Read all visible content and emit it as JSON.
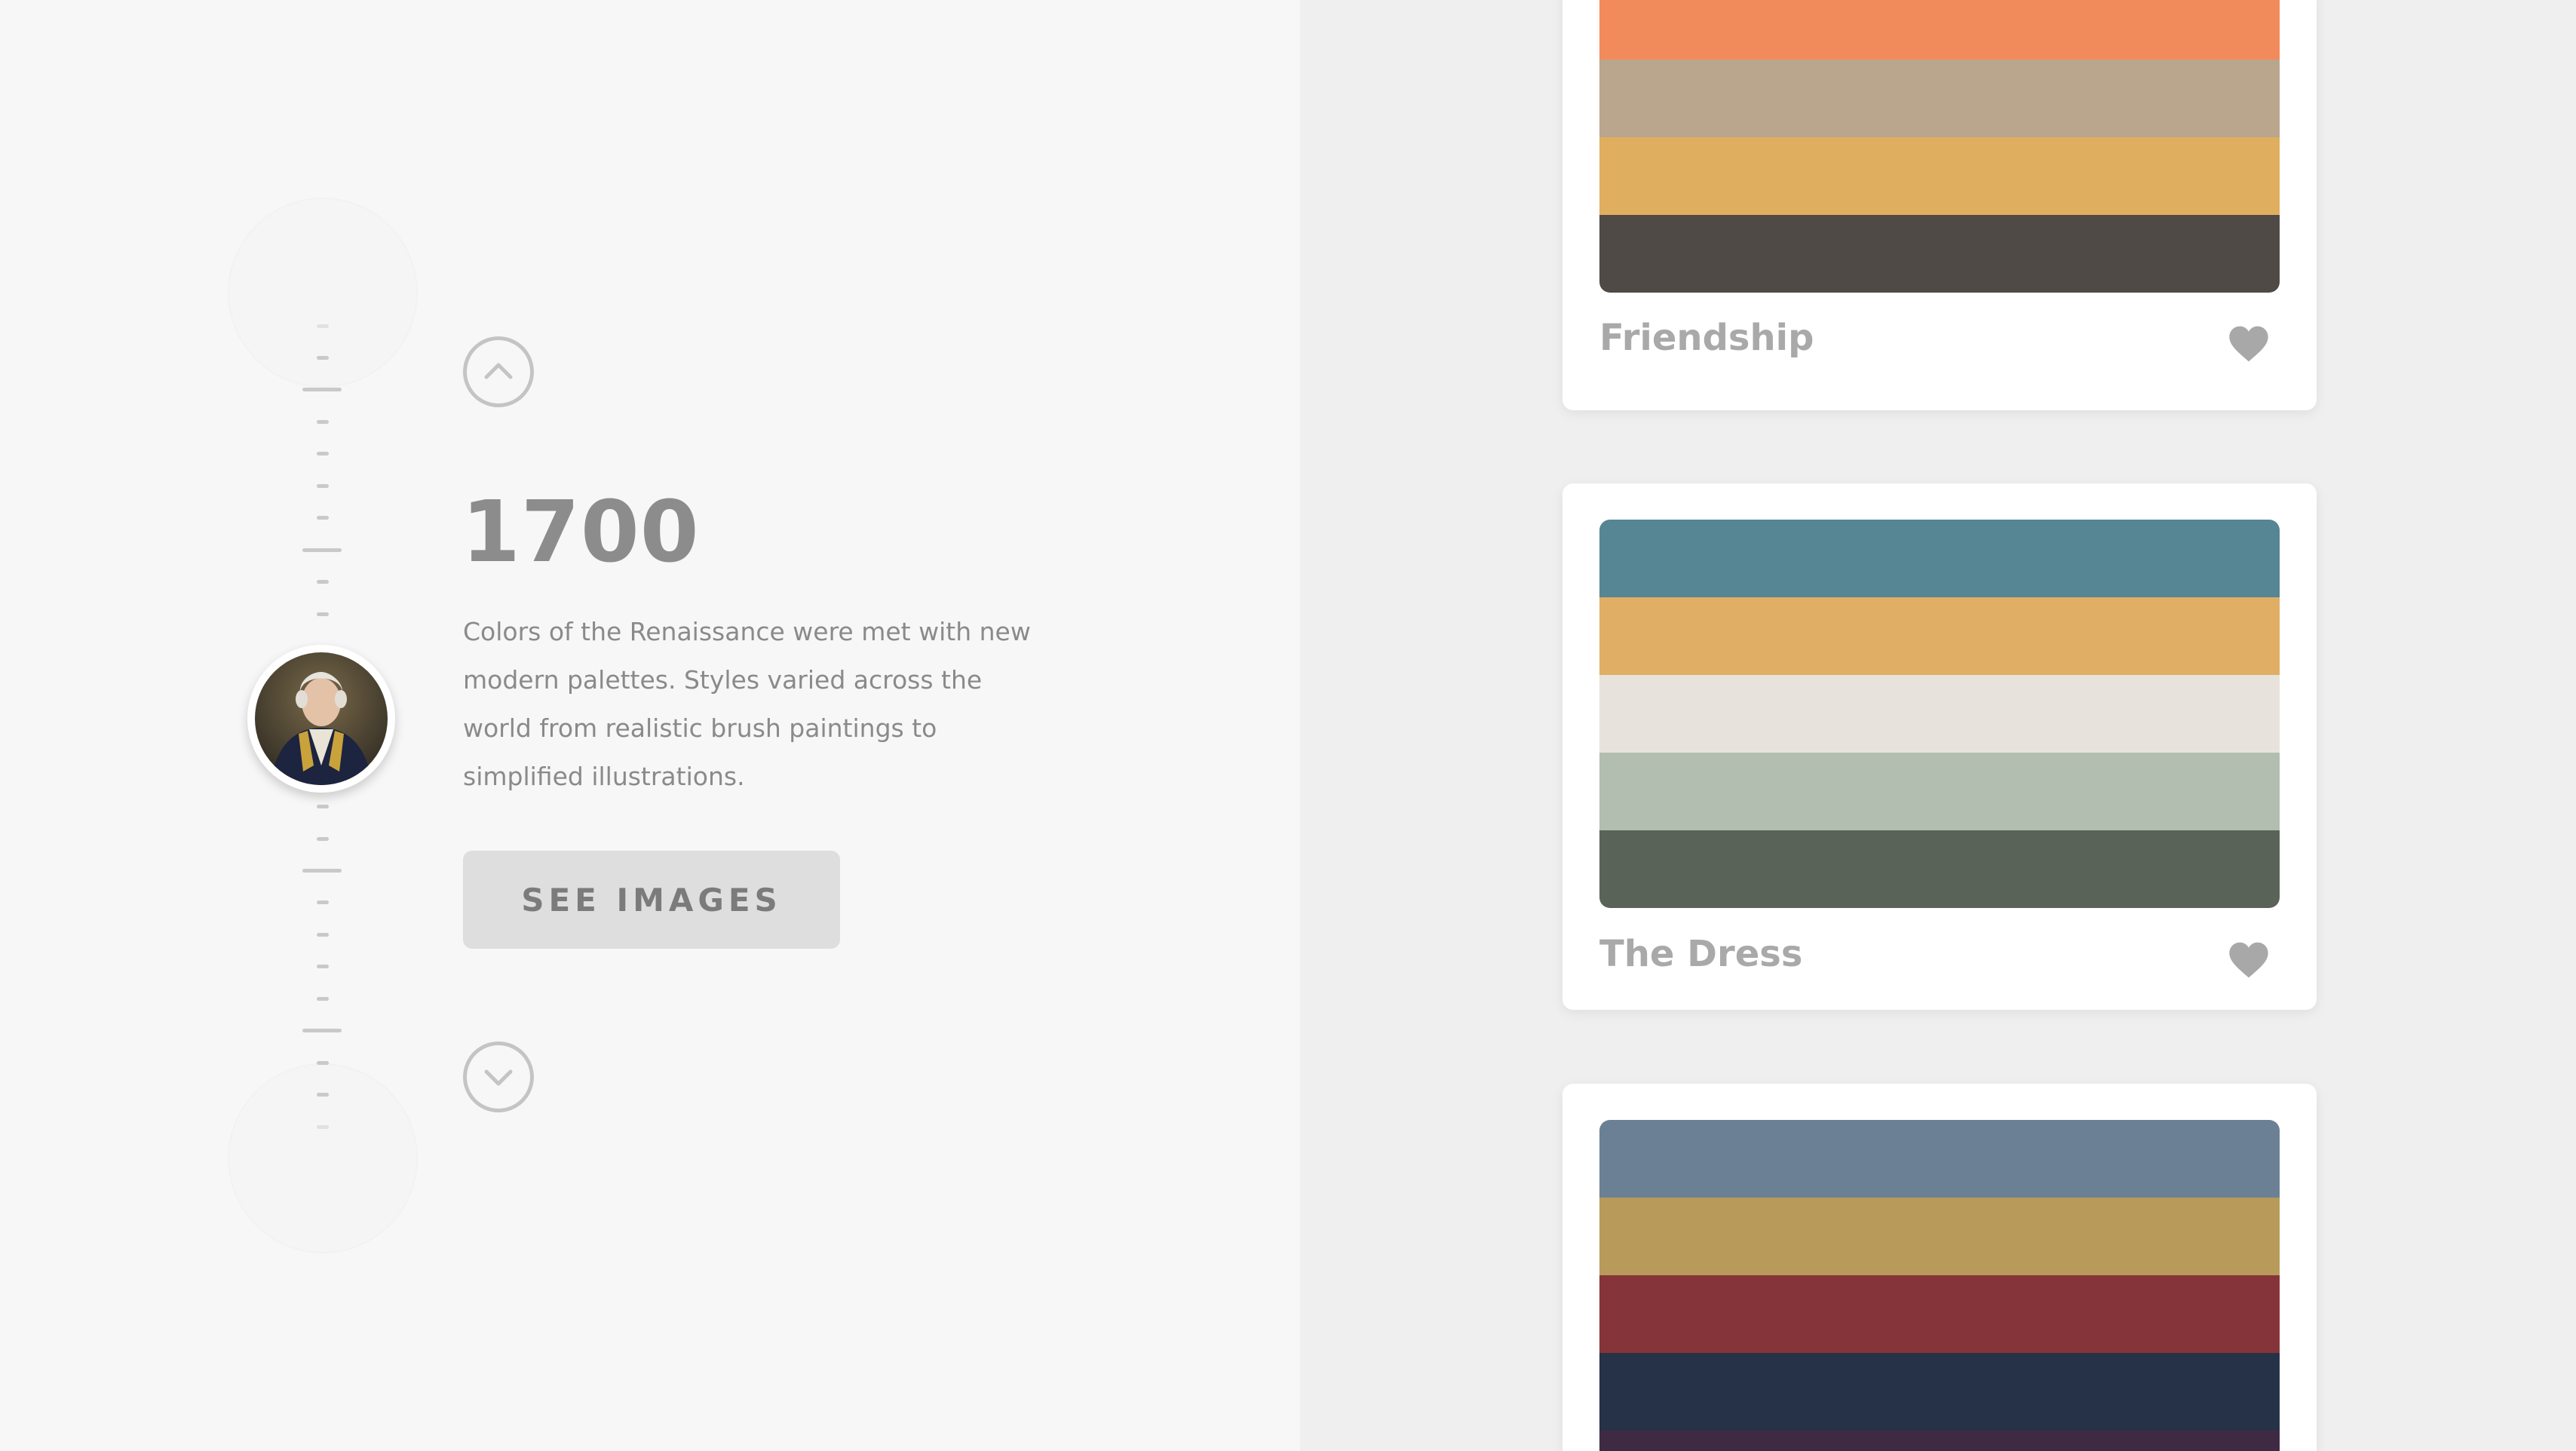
{
  "timeline": {
    "year": "1700",
    "description": "Colors of the Renaissance were met with new modern palettes. Styles varied across the world from realistic brush paintings to simplified illustrations.",
    "see_images_label": "SEE IMAGES",
    "icons": {
      "up": "chevron-up-icon",
      "down": "chevron-down-icon",
      "avatar": "portrait-avatar"
    }
  },
  "palettes": [
    {
      "name": "Friendship",
      "colors": [
        "#f28b5b",
        "#b9a68d",
        "#e0ae5f",
        "#4f4a45"
      ]
    },
    {
      "name": "The Dress",
      "colors": [
        "#568594",
        "#e0ae64",
        "#e7e3dc",
        "#b1beb0",
        "#5a6357"
      ]
    },
    {
      "name": "",
      "colors": [
        "#6c8095",
        "#b89a5a",
        "#853439",
        "#263247",
        "#3f2a44"
      ]
    }
  ],
  "colors": {
    "left_background": "#f7f7f7",
    "right_background": "#efefef",
    "heart": "#a8a8a8"
  }
}
